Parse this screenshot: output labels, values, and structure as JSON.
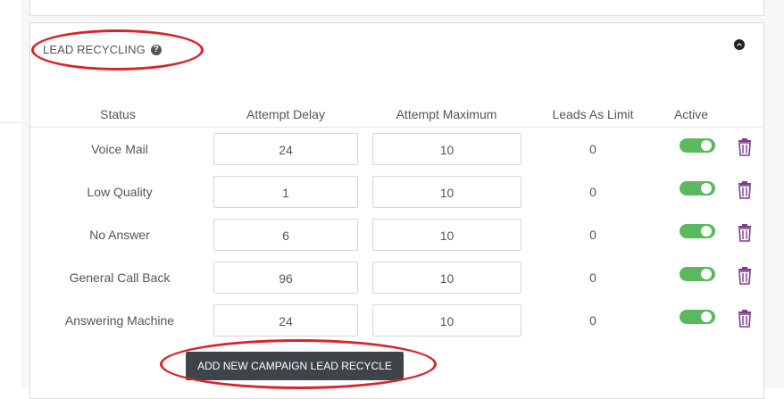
{
  "section": {
    "title": "LEAD RECYCLING",
    "help_icon": "question-circle-icon",
    "collapse_icon": "chevron-up-circle-icon"
  },
  "table": {
    "headers": [
      "Status",
      "Attempt Delay",
      "Attempt Maximum",
      "Leads As Limit",
      "Active"
    ],
    "rows": [
      {
        "status": "Voice Mail",
        "attempt_delay": "24",
        "attempt_maximum": "10",
        "leads_as_limit": "0",
        "active": true
      },
      {
        "status": "Low Quality",
        "attempt_delay": "1",
        "attempt_maximum": "10",
        "leads_as_limit": "0",
        "active": true
      },
      {
        "status": "No Answer",
        "attempt_delay": "6",
        "attempt_maximum": "10",
        "leads_as_limit": "0",
        "active": true
      },
      {
        "status": "General Call Back",
        "attempt_delay": "96",
        "attempt_maximum": "10",
        "leads_as_limit": "0",
        "active": true
      },
      {
        "status": "Answering Machine",
        "attempt_delay": "24",
        "attempt_maximum": "10",
        "leads_as_limit": "0",
        "active": true
      }
    ]
  },
  "actions": {
    "add_label": "ADD NEW CAMPAIGN LEAD RECYCLE"
  },
  "colors": {
    "toggle_on": "#5cb85c",
    "trash": "#7b3f8c",
    "annotation": "#d9242b",
    "button_bg": "#3e4449"
  }
}
